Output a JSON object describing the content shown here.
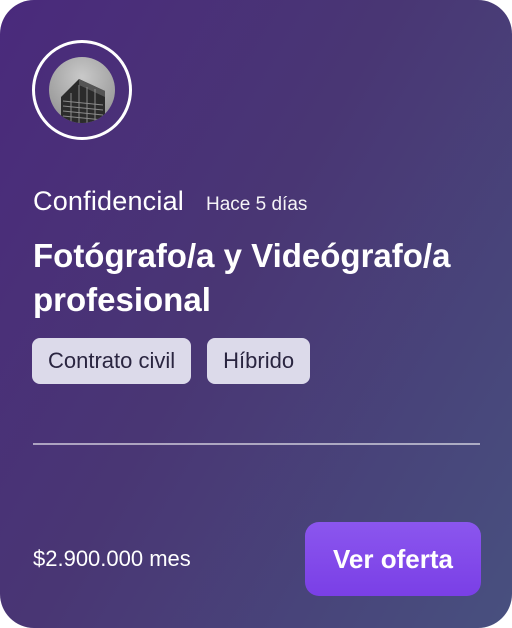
{
  "company": {
    "name": "Confidencial",
    "posted": "Hace 5 días"
  },
  "job": {
    "title": "Fotógrafo/a y Videógrafo/a profesional",
    "tags": [
      "Contrato civil",
      "Híbrido"
    ]
  },
  "salary": "$2.900.000 mes",
  "cta": {
    "label": "Ver oferta"
  },
  "colors": {
    "card_gradient_start": "#4a2a7c",
    "card_gradient_end": "#48507f",
    "tag_bg": "#dcdaea",
    "cta_bg": "#8b56ee"
  },
  "icons": {
    "logo": "building-logo-icon"
  }
}
